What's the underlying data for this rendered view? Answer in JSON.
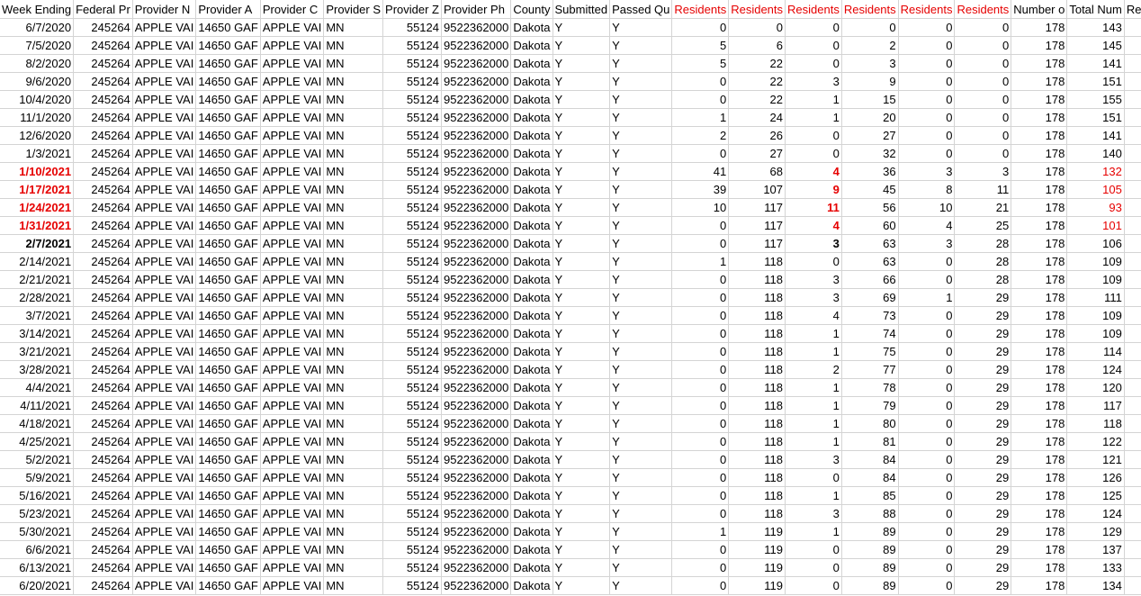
{
  "headers": [
    {
      "label": "Week Ending",
      "red": false
    },
    {
      "label": "Federal Pr",
      "red": false
    },
    {
      "label": "Provider N",
      "red": false
    },
    {
      "label": "Provider A",
      "red": false
    },
    {
      "label": "Provider C",
      "red": false
    },
    {
      "label": "Provider S",
      "red": false
    },
    {
      "label": "Provider Z",
      "red": false
    },
    {
      "label": "Provider Ph",
      "red": false
    },
    {
      "label": "County",
      "red": false
    },
    {
      "label": "Submitted",
      "red": false
    },
    {
      "label": "Passed Qu",
      "red": false
    },
    {
      "label": "Residents",
      "red": true
    },
    {
      "label": "Residents",
      "red": true
    },
    {
      "label": "Residents",
      "red": true
    },
    {
      "label": "Residents",
      "red": true
    },
    {
      "label": "Residents",
      "red": true
    },
    {
      "label": "Residents",
      "red": true
    },
    {
      "label": "Number o",
      "red": false
    },
    {
      "label": "Total Num",
      "red": false
    },
    {
      "label": "Re",
      "red": false
    }
  ],
  "constants": {
    "federal": "245264",
    "provider_name": "APPLE VAI",
    "provider_address": "14650 GAF",
    "provider_city": "APPLE VAI",
    "provider_state": "MN",
    "provider_zip": "55124",
    "provider_phone": "9522362000",
    "county": "Dakota",
    "submitted": "Y",
    "passed": "Y",
    "number_of_beds": "178"
  },
  "rows": [
    {
      "week": "6/7/2020",
      "r1": "0",
      "r2": "0",
      "r3": "0",
      "r4": "0",
      "r5": "0",
      "r6": "0",
      "total": "143"
    },
    {
      "week": "7/5/2020",
      "r1": "5",
      "r2": "6",
      "r3": "0",
      "r4": "2",
      "r5": "0",
      "r6": "0",
      "total": "145"
    },
    {
      "week": "8/2/2020",
      "r1": "5",
      "r2": "22",
      "r3": "0",
      "r4": "3",
      "r5": "0",
      "r6": "0",
      "total": "141"
    },
    {
      "week": "9/6/2020",
      "r1": "0",
      "r2": "22",
      "r3": "3",
      "r4": "9",
      "r5": "0",
      "r6": "0",
      "total": "151"
    },
    {
      "week": "10/4/2020",
      "r1": "0",
      "r2": "22",
      "r3": "1",
      "r4": "15",
      "r5": "0",
      "r6": "0",
      "total": "155"
    },
    {
      "week": "11/1/2020",
      "r1": "1",
      "r2": "24",
      "r3": "1",
      "r4": "20",
      "r5": "0",
      "r6": "0",
      "total": "151"
    },
    {
      "week": "12/6/2020",
      "r1": "2",
      "r2": "26",
      "r3": "0",
      "r4": "27",
      "r5": "0",
      "r6": "0",
      "total": "141"
    },
    {
      "week": "1/3/2021",
      "r1": "0",
      "r2": "27",
      "r3": "0",
      "r4": "32",
      "r5": "0",
      "r6": "0",
      "total": "140"
    },
    {
      "week": "1/10/2021",
      "r1": "41",
      "r2": "68",
      "r3": "4",
      "r4": "36",
      "r5": "3",
      "r6": "3",
      "total": "132",
      "week_red": true,
      "r3_red": true,
      "total_red": true
    },
    {
      "week": "1/17/2021",
      "r1": "39",
      "r2": "107",
      "r3": "9",
      "r4": "45",
      "r5": "8",
      "r6": "11",
      "total": "105",
      "week_red": true,
      "r3_red": true,
      "total_red": true
    },
    {
      "week": "1/24/2021",
      "r1": "10",
      "r2": "117",
      "r3": "11",
      "r4": "56",
      "r5": "10",
      "r6": "21",
      "total": "93",
      "week_red": true,
      "r3_red": true,
      "total_red": true
    },
    {
      "week": "1/31/2021",
      "r1": "0",
      "r2": "117",
      "r3": "4",
      "r4": "60",
      "r5": "4",
      "r6": "25",
      "total": "101",
      "week_red": true,
      "r3_red": true,
      "total_red": true
    },
    {
      "week": "2/7/2021",
      "r1": "0",
      "r2": "117",
      "r3": "3",
      "r4": "63",
      "r5": "3",
      "r6": "28",
      "total": "106",
      "week_bold": true,
      "r3_bold": true
    },
    {
      "week": "2/14/2021",
      "r1": "1",
      "r2": "118",
      "r3": "0",
      "r4": "63",
      "r5": "0",
      "r6": "28",
      "total": "109"
    },
    {
      "week": "2/21/2021",
      "r1": "0",
      "r2": "118",
      "r3": "3",
      "r4": "66",
      "r5": "0",
      "r6": "28",
      "total": "109"
    },
    {
      "week": "2/28/2021",
      "r1": "0",
      "r2": "118",
      "r3": "3",
      "r4": "69",
      "r5": "1",
      "r6": "29",
      "total": "111"
    },
    {
      "week": "3/7/2021",
      "r1": "0",
      "r2": "118",
      "r3": "4",
      "r4": "73",
      "r5": "0",
      "r6": "29",
      "total": "109"
    },
    {
      "week": "3/14/2021",
      "r1": "0",
      "r2": "118",
      "r3": "1",
      "r4": "74",
      "r5": "0",
      "r6": "29",
      "total": "109"
    },
    {
      "week": "3/21/2021",
      "r1": "0",
      "r2": "118",
      "r3": "1",
      "r4": "75",
      "r5": "0",
      "r6": "29",
      "total": "114"
    },
    {
      "week": "3/28/2021",
      "r1": "0",
      "r2": "118",
      "r3": "2",
      "r4": "77",
      "r5": "0",
      "r6": "29",
      "total": "124"
    },
    {
      "week": "4/4/2021",
      "r1": "0",
      "r2": "118",
      "r3": "1",
      "r4": "78",
      "r5": "0",
      "r6": "29",
      "total": "120"
    },
    {
      "week": "4/11/2021",
      "r1": "0",
      "r2": "118",
      "r3": "1",
      "r4": "79",
      "r5": "0",
      "r6": "29",
      "total": "117"
    },
    {
      "week": "4/18/2021",
      "r1": "0",
      "r2": "118",
      "r3": "1",
      "r4": "80",
      "r5": "0",
      "r6": "29",
      "total": "118"
    },
    {
      "week": "4/25/2021",
      "r1": "0",
      "r2": "118",
      "r3": "1",
      "r4": "81",
      "r5": "0",
      "r6": "29",
      "total": "122"
    },
    {
      "week": "5/2/2021",
      "r1": "0",
      "r2": "118",
      "r3": "3",
      "r4": "84",
      "r5": "0",
      "r6": "29",
      "total": "121"
    },
    {
      "week": "5/9/2021",
      "r1": "0",
      "r2": "118",
      "r3": "0",
      "r4": "84",
      "r5": "0",
      "r6": "29",
      "total": "126"
    },
    {
      "week": "5/16/2021",
      "r1": "0",
      "r2": "118",
      "r3": "1",
      "r4": "85",
      "r5": "0",
      "r6": "29",
      "total": "125"
    },
    {
      "week": "5/23/2021",
      "r1": "0",
      "r2": "118",
      "r3": "3",
      "r4": "88",
      "r5": "0",
      "r6": "29",
      "total": "124"
    },
    {
      "week": "5/30/2021",
      "r1": "1",
      "r2": "119",
      "r3": "1",
      "r4": "89",
      "r5": "0",
      "r6": "29",
      "total": "129"
    },
    {
      "week": "6/6/2021",
      "r1": "0",
      "r2": "119",
      "r3": "0",
      "r4": "89",
      "r5": "0",
      "r6": "29",
      "total": "137"
    },
    {
      "week": "6/13/2021",
      "r1": "0",
      "r2": "119",
      "r3": "0",
      "r4": "89",
      "r5": "0",
      "r6": "29",
      "total": "133"
    },
    {
      "week": "6/20/2021",
      "r1": "0",
      "r2": "119",
      "r3": "0",
      "r4": "89",
      "r5": "0",
      "r6": "29",
      "total": "134"
    }
  ]
}
